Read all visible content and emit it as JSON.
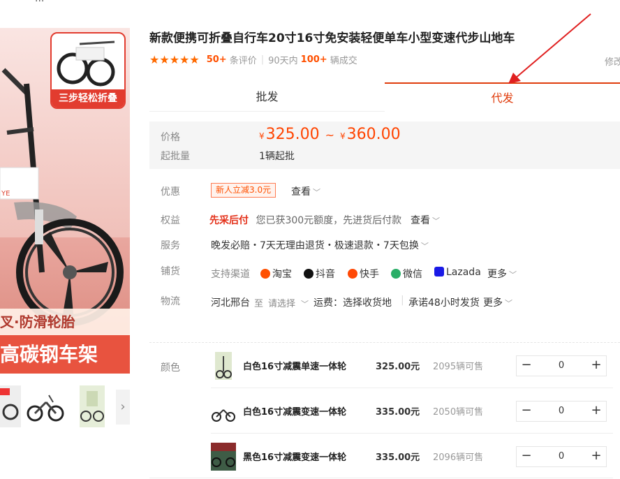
{
  "product": {
    "title": "新款便携可折叠自行车20寸16寸免安装轻便单车小型变速代步山地车",
    "rating_stars": "★★★★★",
    "review_count": "50+",
    "review_label": "条评价",
    "period_label": "90天内",
    "sold_count": "100+",
    "sold_label": "辆成交",
    "edit_link": "修改"
  },
  "gallery": {
    "badge_text": "三步轻松折叠",
    "promo_line1": "叉·防滑轮胎",
    "promo_line2": "高碳钢车架",
    "arrow": "›"
  },
  "tabs": [
    {
      "label": "批发",
      "active": false
    },
    {
      "label": "代发",
      "active": true
    }
  ],
  "price": {
    "label": "价格",
    "currency": "¥",
    "min": "325.00",
    "tilde": "~",
    "max": "360.00",
    "moq_label": "起批量",
    "moq_value": "1辆起批"
  },
  "offers": {
    "label": "优惠",
    "coupon": "新人立减3.0元",
    "view": "查看"
  },
  "benefits": {
    "label": "权益",
    "highlight": "先采后付",
    "text": "您已获300元额度，先进货后付款",
    "view": "查看"
  },
  "service": {
    "label": "服务",
    "text": "晚发必赔・7天无理由退货・极速退款・7天包换"
  },
  "channels": {
    "label": "铺货",
    "intro": "支持渠道",
    "items": [
      {
        "name": "淘宝",
        "color": "#ff5000"
      },
      {
        "name": "抖音",
        "color": "#111111"
      },
      {
        "name": "快手",
        "color": "#ff4906"
      },
      {
        "name": "微信",
        "color": "#2aae67"
      },
      {
        "name": "Lazada",
        "color": "#1a1ae6"
      }
    ],
    "more": "更多"
  },
  "logistics": {
    "label": "物流",
    "from": "河北邢台",
    "to_word": "至",
    "select_placeholder": "请选择",
    "freight": "运费：选择收货地",
    "promise": "承诺48小时发货",
    "more": "更多"
  },
  "sku": {
    "label": "颜色",
    "rows": [
      {
        "name": "白色16寸减震单速一体轮",
        "price": "325.00元",
        "stock": "2095辆可售",
        "qty": "0"
      },
      {
        "name": "白色16寸减震变速一体轮",
        "price": "335.00元",
        "stock": "2050辆可售",
        "qty": "0"
      },
      {
        "name": "黑色16寸减震变速一体轮",
        "price": "335.00元",
        "stock": "2096辆可售",
        "qty": "0"
      }
    ],
    "minus": "−",
    "plus": "+"
  },
  "colors": {
    "accent": "#e03c0c",
    "price": "#ff4400",
    "star": "#ff6a00"
  }
}
